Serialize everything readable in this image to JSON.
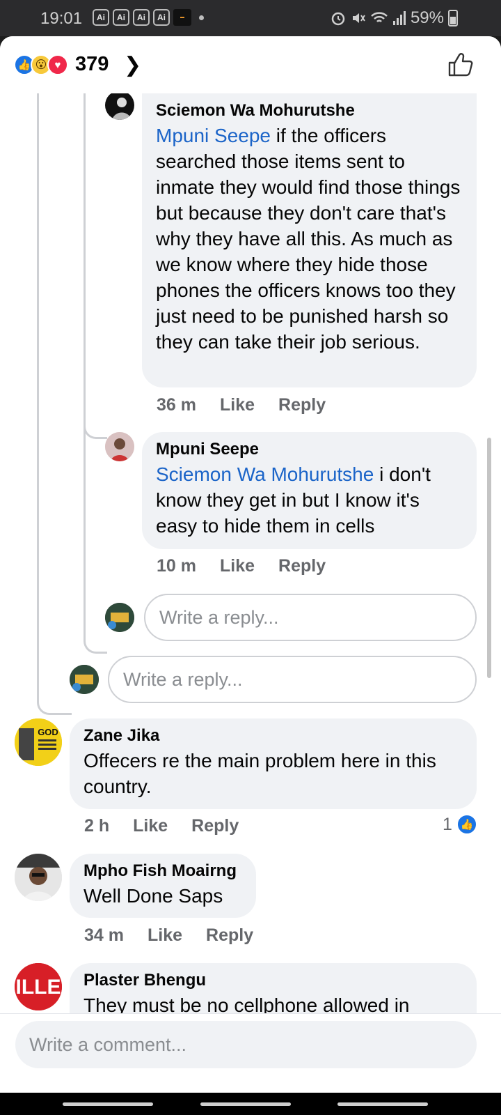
{
  "status": {
    "time": "19:01",
    "app_icons": [
      "Ai",
      "Ai",
      "Ai",
      "Ai"
    ],
    "battery": "59%"
  },
  "header": {
    "reaction_count": "379",
    "reactions": [
      "like-icon",
      "wow-icon",
      "love-icon"
    ]
  },
  "comments": [
    {
      "name": "Sciemon Wa Mohurutshe",
      "mention": "Mpuni Seepe",
      "text": " if the officers searched those items sent to inmate they would find those things but because they don't care that's why they have all this. As much as we know where they hide those phones the officers knows too they just need to be punished harsh so they can take their job serious.",
      "time": "36 m",
      "like": "Like",
      "reply": "Reply"
    },
    {
      "name": "Mpuni Seepe",
      "mention": "Sciemon Wa Mohurutshe",
      "text": " i don't know they get in but I know it's easy to hide them in cells",
      "time": "10 m",
      "like": "Like",
      "reply": "Reply"
    },
    {
      "name": "Zane Jika",
      "text": "Offecers re the main problem here in this country.",
      "time": "2 h",
      "like": "Like",
      "reply": "Reply",
      "likes": "1"
    },
    {
      "name": "Mpho Fish Moairng",
      "text": "Well Done Saps",
      "time": "34 m",
      "like": "Like",
      "reply": "Reply"
    },
    {
      "name": "Plaster Bhengu",
      "text": "They must be no cellphone allowed in"
    }
  ],
  "reply_placeholder": "Write a reply...",
  "comment_placeholder": "Write a comment...",
  "avatar_texts": {
    "zane": "GOD",
    "plaster": "ILLE"
  },
  "colors": {
    "facebook_blue": "#1b74e4",
    "mention": "#1b64c8",
    "bubble": "#f0f2f5"
  }
}
